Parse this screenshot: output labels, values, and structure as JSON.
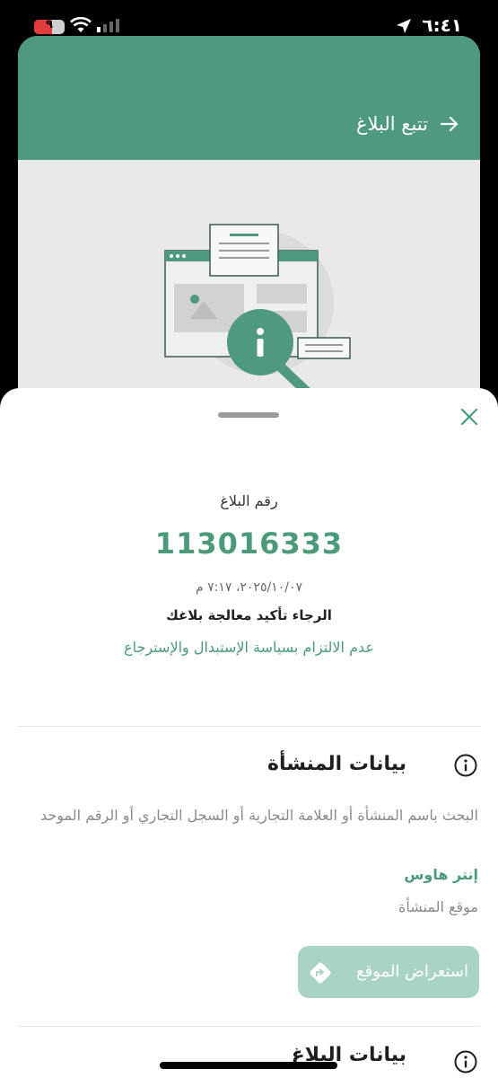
{
  "status_bar": {
    "time": "٦:٤١",
    "battery_level": "٩",
    "icons": [
      "location-arrow-icon",
      "signal-icon",
      "wifi-icon",
      "battery-icon"
    ]
  },
  "background_screen": {
    "title": "تتبع البلاغ",
    "back_icon": "arrow-icon",
    "illustration": "report-search-illustration"
  },
  "sheet": {
    "report_label": "رقم البلاغ",
    "report_number": "113016333",
    "report_date": "٢٠٢٥/١٠/٠٧، ٧:١٧ م",
    "confirm_text": "الرجاء تأكيد معالجة بلاغك",
    "violation": "عدم الالتزام بسياسة الإستبدال والإسترجاع",
    "close_icon": "close-icon",
    "establishment": {
      "title": "بيانات المنشأة",
      "icon": "info-icon",
      "search_desc": "البحث باسم المنشأة أو العلامة التجارية أو السجل التجاري أو الرقم الموحد",
      "company_name": "إنتر هاوس",
      "location_label": "موقع المنشأة",
      "map_button": "استعراض الموقع",
      "map_icon": "directions-icon"
    },
    "report_section": {
      "title": "بيانات البلاغ",
      "icon": "info-icon"
    }
  },
  "colors": {
    "brand_green": "#4f9a7f",
    "accent_green": "#4b9b7a",
    "button_disabled": "#a9d4c3"
  }
}
